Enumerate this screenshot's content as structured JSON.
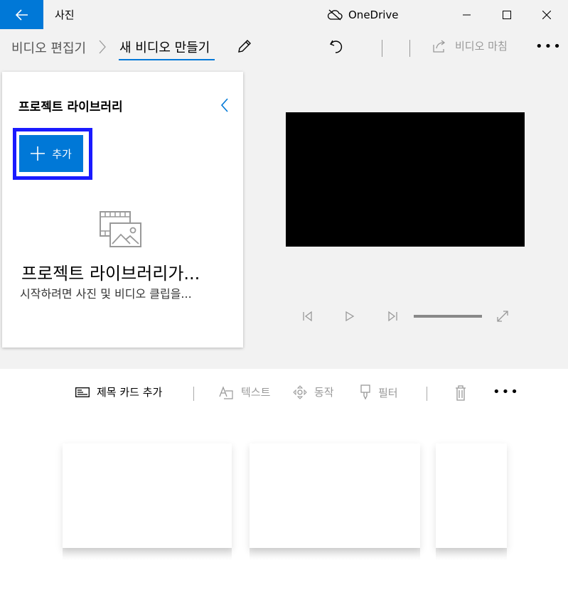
{
  "titlebar": {
    "app_title": "사진",
    "onedrive_label": "OneDrive"
  },
  "nav": {
    "breadcrumb_parent": "비디오 편집기",
    "breadcrumb_current": "새 비디오 만들기",
    "finish_label": "비디오 마침"
  },
  "library": {
    "title": "프로젝트 라이브러리",
    "add_label": "추가",
    "empty_title": "프로젝트 라이브러리가...",
    "empty_subtitle": "시작하려면 사진 및 비디오 클립을..."
  },
  "storyboard": {
    "title_card_label": "제목 카드 추가",
    "text_label": "텍스트",
    "motion_label": "동작",
    "filter_label": "필터"
  },
  "colors": {
    "accent": "#0078d7",
    "highlight_outline": "#1a1aff"
  }
}
